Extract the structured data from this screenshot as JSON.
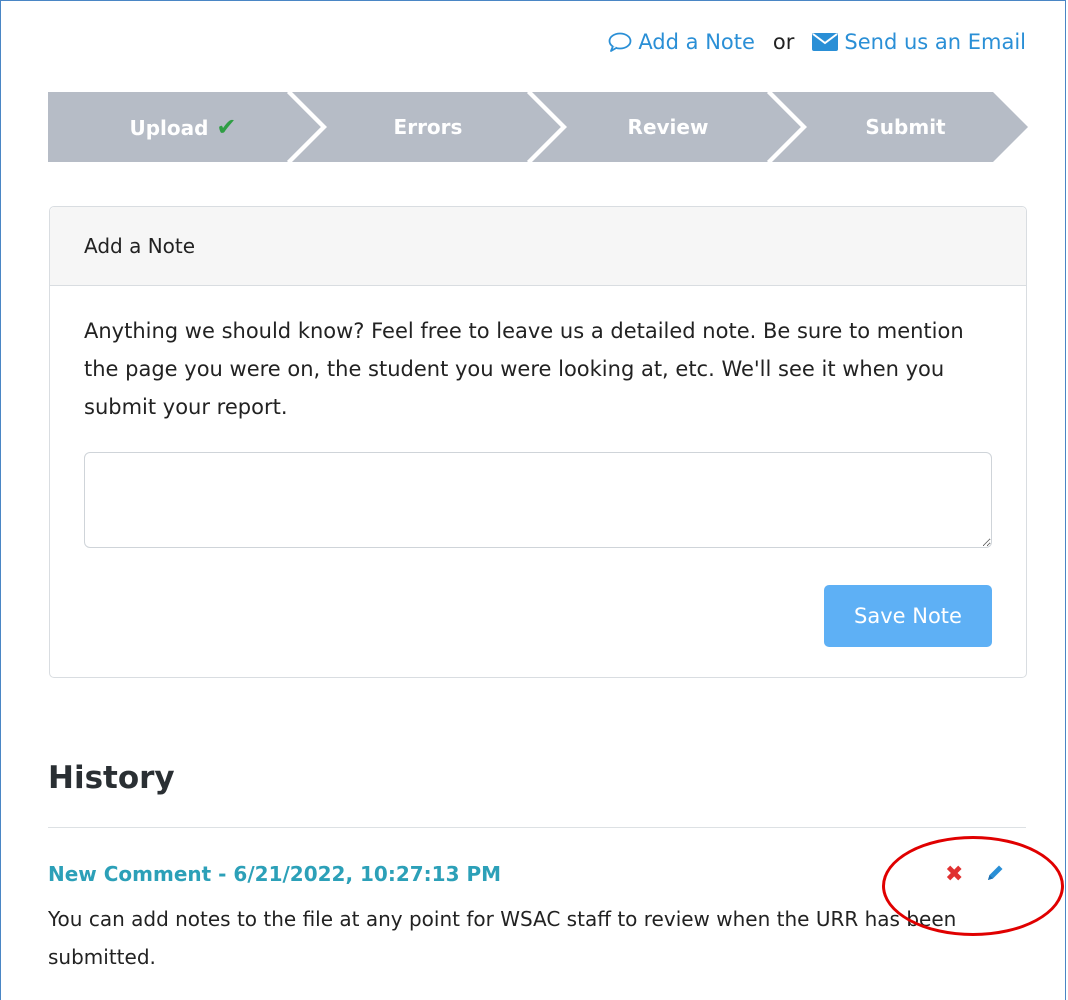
{
  "header": {
    "add_note_link": "Add a Note",
    "or_text": "or",
    "email_link": "Send us an Email"
  },
  "steps": [
    {
      "label": "Upload",
      "completed": true
    },
    {
      "label": "Errors",
      "completed": false
    },
    {
      "label": "Review",
      "completed": false
    },
    {
      "label": "Submit",
      "completed": false
    }
  ],
  "note_card": {
    "title": "Add a Note",
    "description": "Anything we should know? Feel free to leave us a detailed note. Be sure to mention the page you were on, the student you were looking at, etc. We'll see it when you submit your report.",
    "textarea_value": "",
    "save_label": "Save Note"
  },
  "history": {
    "title": "History",
    "entries": [
      {
        "heading": "New Comment - 6/21/2022, 10:27:13 PM",
        "body": "You can add notes to the file at any point for WSAC staff to review when the URR has been submitted."
      }
    ]
  },
  "icons": {
    "add_note": "speech-bubble-icon",
    "email": "envelope-icon",
    "check": "checkmark-icon",
    "delete": "close-icon",
    "edit": "pencil-icon"
  },
  "colors": {
    "link": "#2a8fd6",
    "step_fill": "#b6bcc6",
    "check": "#2f9e44",
    "save_button": "#5eb0f5",
    "comment_heading": "#2ca0b8",
    "delete": "#e03131",
    "annotation_circle": "#e00000"
  }
}
